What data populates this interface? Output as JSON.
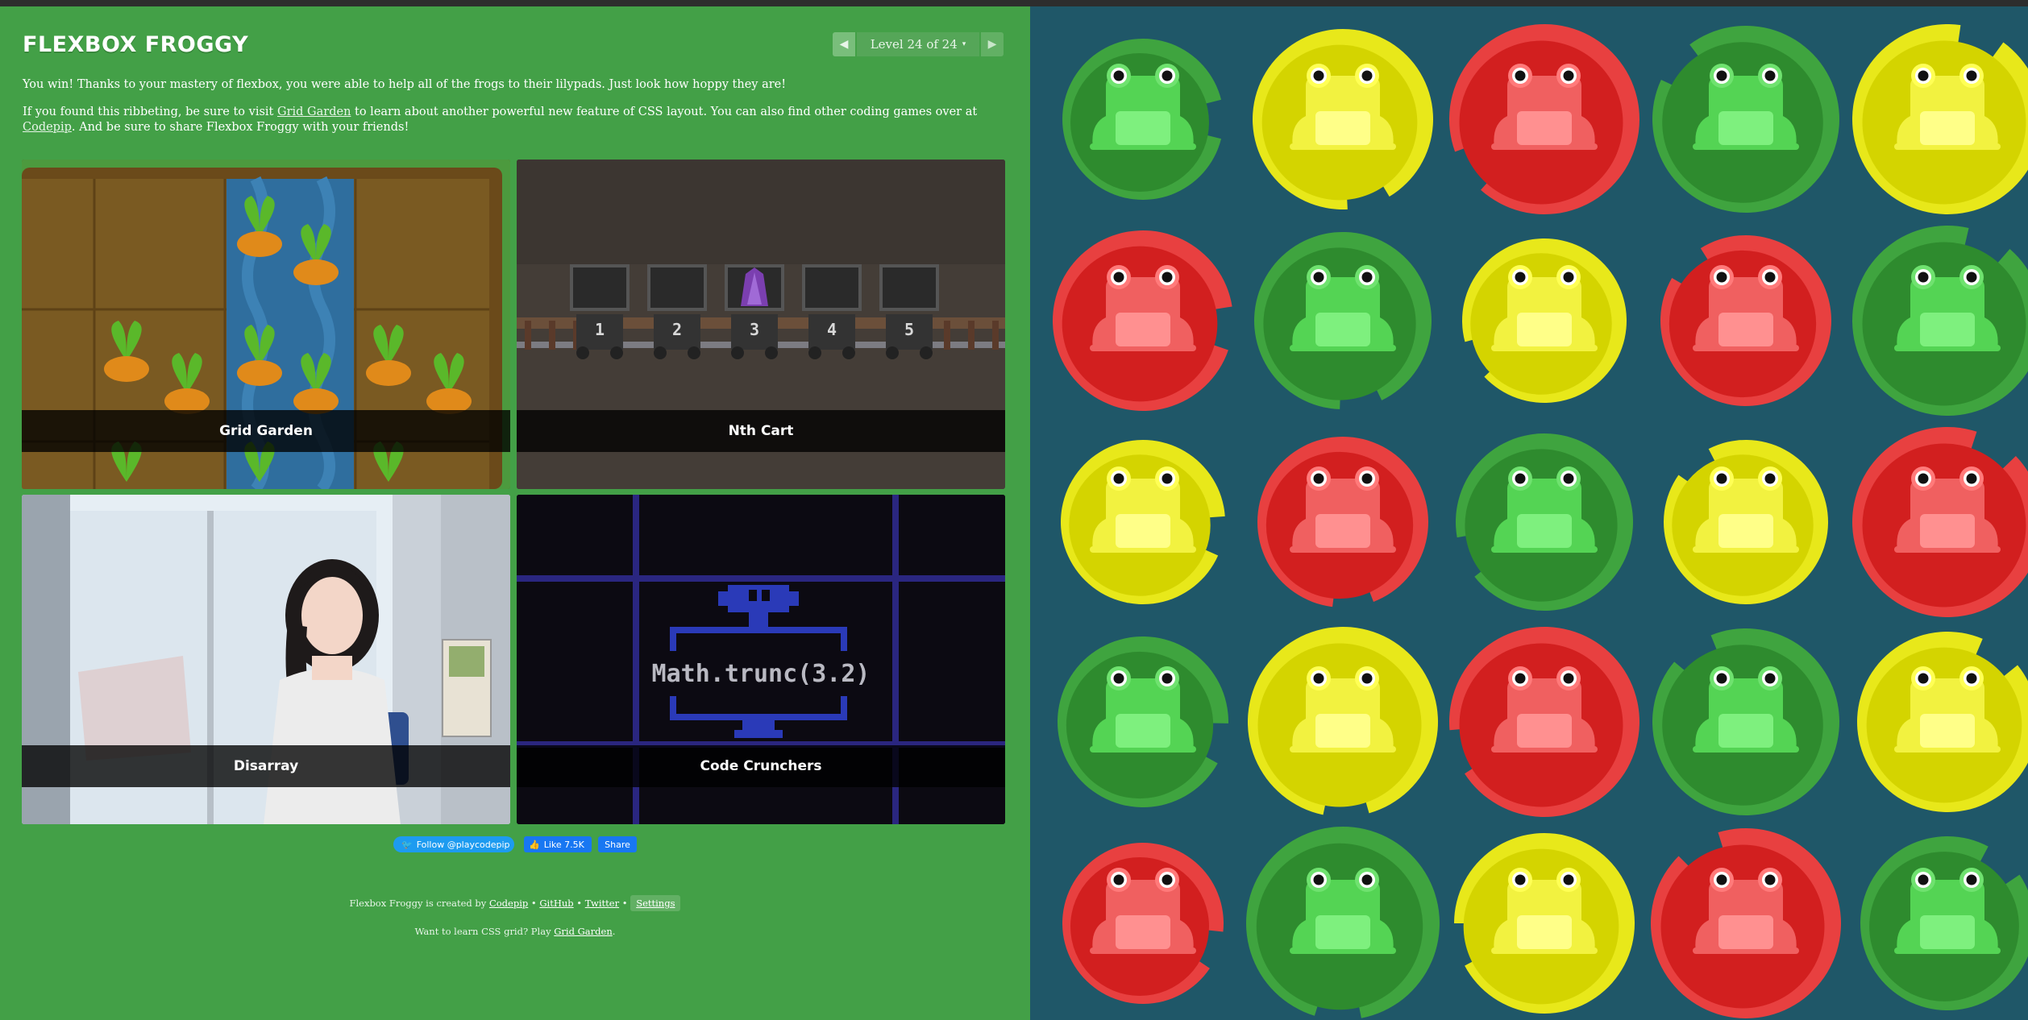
{
  "app": {
    "title": "FLEXBOX FROGGY"
  },
  "level": {
    "prev_icon": "triangle-left-icon",
    "indicator": "Level 24 of 24",
    "caret": "▾",
    "next_icon": "triangle-right-icon"
  },
  "messages": {
    "win": "You win! Thanks to your mastery of flexbox, you were able to help all of the frogs to their lilypads. Just look how hoppy they are!",
    "share_p1": "If you found this ribbeting, be sure to visit ",
    "share_link1": "Grid Garden",
    "share_p2": " to learn about another powerful new feature of CSS layout. You can also find other coding games over at ",
    "share_link2": "Codepip",
    "share_p3": ". And be sure to share Flexbox Froggy with your friends!"
  },
  "games": {
    "garden": "Grid Garden",
    "cart": "Nth Cart",
    "cart_numbers": [
      "1",
      "2",
      "3",
      "4",
      "5"
    ],
    "disarray": "Disarray",
    "crunch": "Code Crunchers",
    "crunch_code": "Math.trunc(3.2)"
  },
  "social": {
    "twitter": "Follow @playcodepip",
    "like": "Like 7.5K",
    "share": "Share"
  },
  "footer": {
    "created_by": "Flexbox Froggy is created by ",
    "codepip": "Codepip",
    "sep": " • ",
    "github": "GitHub",
    "twitter": "Twitter",
    "settings": "Settings",
    "learn_grid": "Want to learn CSS grid? Play ",
    "grid_garden": "Grid Garden",
    "period": "."
  },
  "colors": {
    "sidebar": "#43a047",
    "pond": "#1f5768",
    "green": "#2e8b2e",
    "yellow": "#d4d400",
    "red": "#d21f1f"
  },
  "pond": {
    "rows": [
      [
        "green",
        "yellow",
        "red",
        "green",
        "yellow"
      ],
      [
        "red",
        "green",
        "yellow",
        "red",
        "green"
      ],
      [
        "yellow",
        "red",
        "green",
        "yellow",
        "red"
      ],
      [
        "green",
        "yellow",
        "red",
        "green",
        "yellow"
      ],
      [
        "red",
        "green",
        "yellow",
        "red",
        "green"
      ]
    ]
  }
}
